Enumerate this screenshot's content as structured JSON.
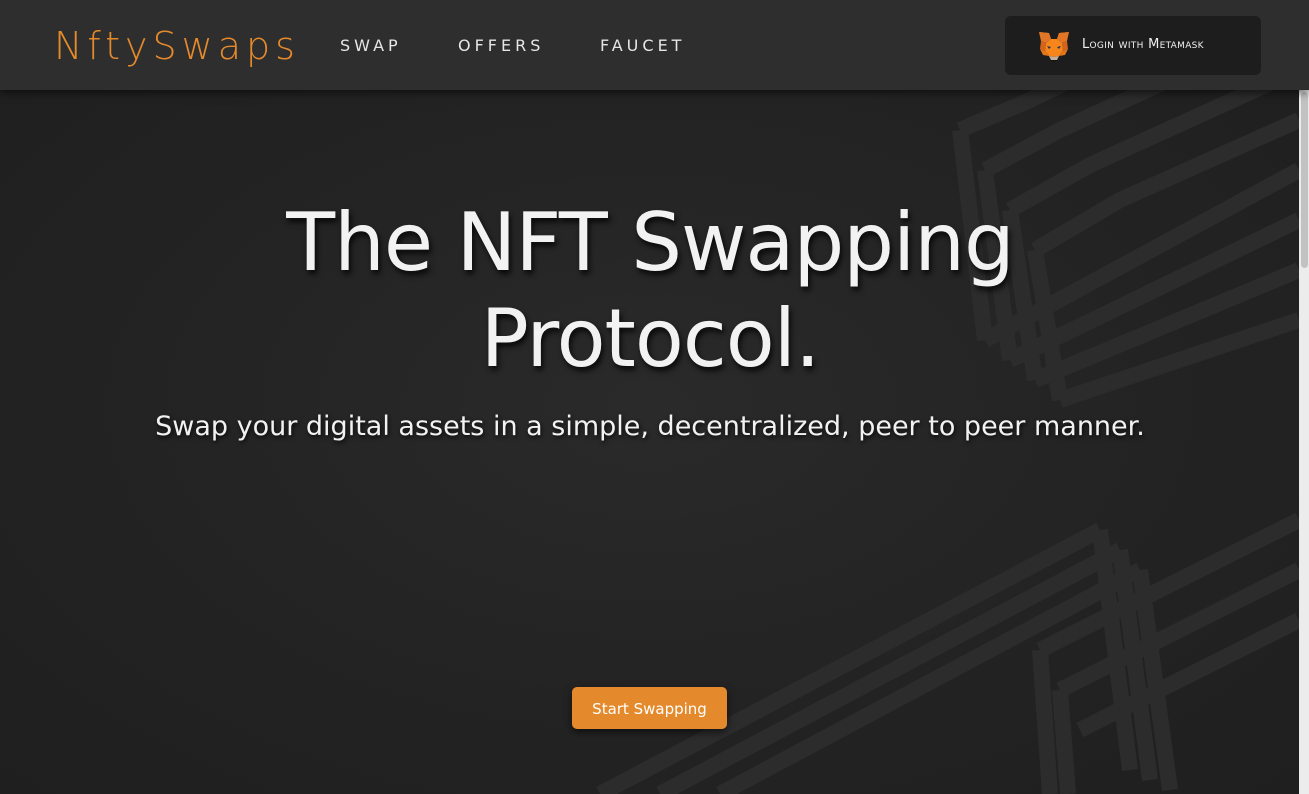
{
  "nav": {
    "brand": "NftySwaps",
    "links": [
      "SWAP",
      "OFFERS",
      "FAUCET"
    ],
    "login_label": "Login with Metamask",
    "login_icon": "metamask-fox-icon"
  },
  "hero": {
    "title": "The NFT Swapping Protocol.",
    "subtitle": "Swap your digital assets in a simple, decentralized, peer to peer manner.",
    "cta_label": "Start Swapping"
  },
  "colors": {
    "accent": "#e58a2c",
    "nav_background": "#2e2e2e",
    "hero_background": "#232323",
    "text": "#f2f2f2"
  }
}
